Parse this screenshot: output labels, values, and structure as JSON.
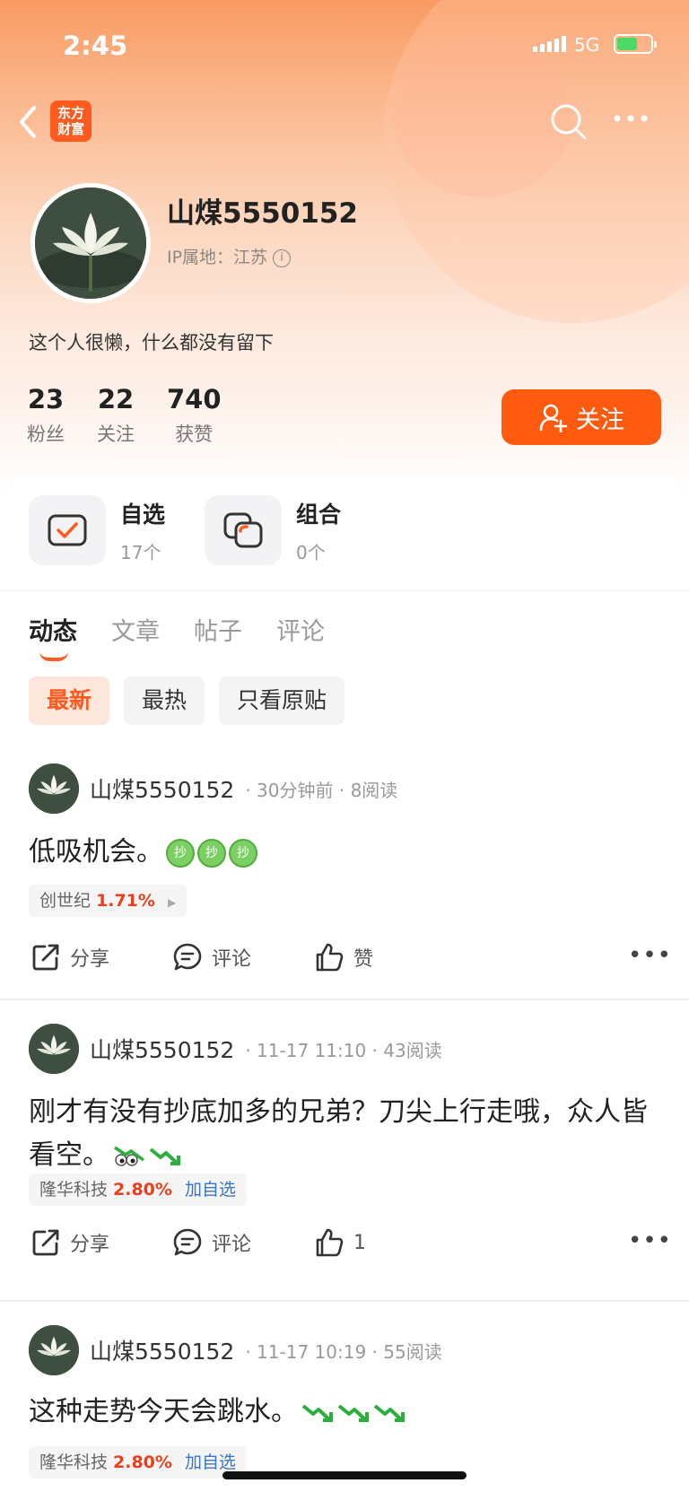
{
  "status": {
    "time": "2:45",
    "network": "5G"
  },
  "nav": {
    "logo_line1": "东方",
    "logo_line2": "财富"
  },
  "profile": {
    "name": "山煤5550152",
    "ip_location": "IP属地：江苏",
    "bio": "这个人很懒，什么都没有留下",
    "stats": [
      {
        "num": "23",
        "label": "粉丝"
      },
      {
        "num": "22",
        "label": "关注"
      },
      {
        "num": "740",
        "label": "获赞"
      }
    ],
    "follow_label": "关注"
  },
  "quick": [
    {
      "title": "自选",
      "sub": "17个",
      "icon": "watchlist-check-icon"
    },
    {
      "title": "组合",
      "sub": "0个",
      "icon": "portfolio-icon"
    }
  ],
  "tabs": [
    "动态",
    "文章",
    "帖子",
    "评论"
  ],
  "filters": [
    "最新",
    "最热",
    "只看原贴"
  ],
  "posts": [
    {
      "author": "山煤5550152",
      "meta": "· 30分钟前 · 8阅读",
      "text": "低吸机会。",
      "stock": "创世纪",
      "pct": "1.71%",
      "add": "",
      "share": "分享",
      "comment": "评论",
      "like": "赞"
    },
    {
      "author": "山煤5550152",
      "meta": "· 11-17 11:10 · 43阅读",
      "text": "刚才有没有抄底加多的兄弟？刀尖上行走哦，众人皆看空。",
      "stock": "隆华科技",
      "pct": "2.80%",
      "add": "加自选",
      "share": "分享",
      "comment": "评论",
      "like": "1"
    },
    {
      "author": "山煤5550152",
      "meta": "· 11-17 10:19 · 55阅读",
      "text": "这种走势今天会跳水。",
      "stock": "隆华科技",
      "pct": "2.80%",
      "add": "加自选"
    }
  ],
  "emoji_label": "抄",
  "colors": {
    "accent": "#ff5a0d",
    "up": "#e8401c",
    "link": "#3c74c8"
  }
}
